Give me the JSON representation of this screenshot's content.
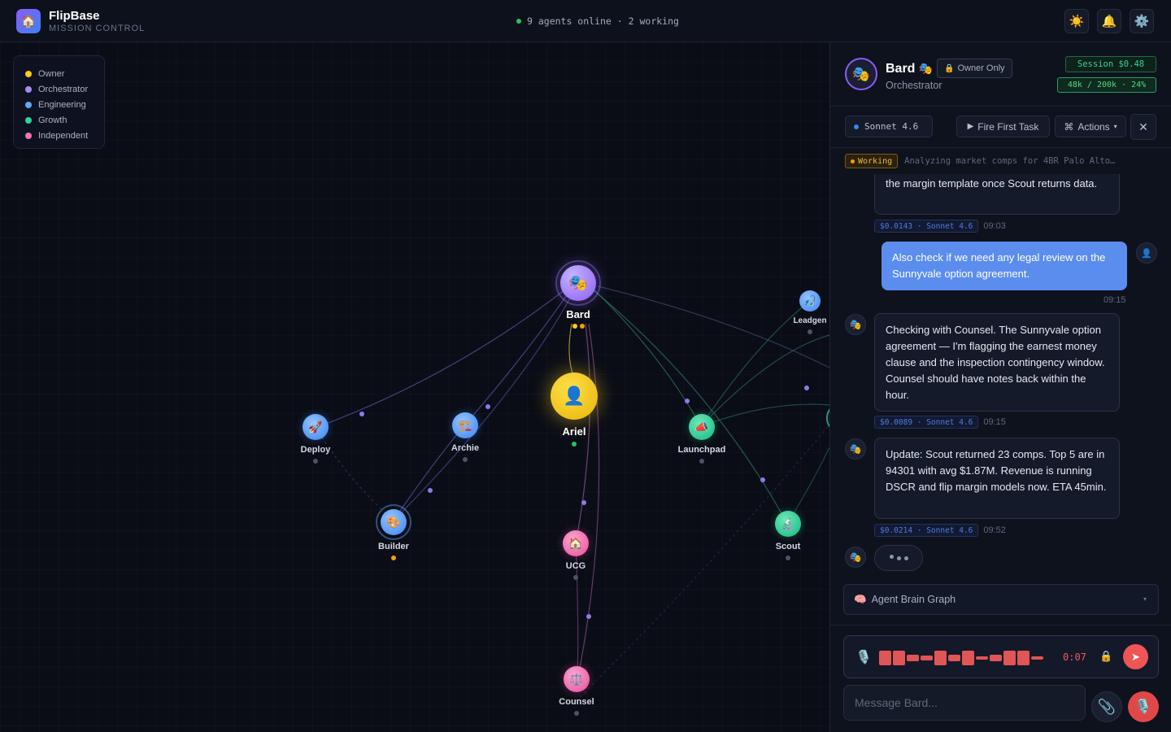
{
  "header": {
    "app_name": "FlipBase",
    "app_subtitle": "MISSION CONTROL",
    "logo_icon": "🏠",
    "online_status": "9 agents online · 2 working",
    "theme_icon": "☀️",
    "bell_icon": "🔔",
    "settings_icon": "⚙️"
  },
  "legend": {
    "items": [
      {
        "label": "Owner",
        "color": "#facc15"
      },
      {
        "label": "Orchestrator",
        "color": "#a78bfa"
      },
      {
        "label": "Engineering",
        "color": "#60a5fa"
      },
      {
        "label": "Growth",
        "color": "#34d399"
      },
      {
        "label": "Independent",
        "color": "#f472b6"
      }
    ]
  },
  "graph": {
    "nodes": [
      {
        "id": "bard",
        "label": "Bard",
        "icon": "🎭",
        "color": "#a78bfa",
        "group": "Orchestrator"
      },
      {
        "id": "ariel",
        "label": "Ariel",
        "icon": "👤",
        "color": "#facc15",
        "group": "Owner"
      },
      {
        "id": "deploy",
        "label": "Deploy",
        "icon": "🚀",
        "color": "#60a5fa",
        "group": "Engineering"
      },
      {
        "id": "archie",
        "label": "Archie",
        "icon": "🏗️",
        "color": "#60a5fa",
        "group": "Engineering"
      },
      {
        "id": "builder",
        "label": "Builder",
        "icon": "🎨",
        "color": "#60a5fa",
        "group": "Engineering"
      },
      {
        "id": "launchpad",
        "label": "Launchpad",
        "icon": "📣",
        "color": "#34d399",
        "group": "Growth"
      },
      {
        "id": "leadgen",
        "label": "Leadgen",
        "icon": "🎣",
        "color": "#60a5fa",
        "group": "Growth"
      },
      {
        "id": "scout",
        "label": "Scout",
        "icon": "🔬",
        "color": "#34d399",
        "group": "Growth"
      },
      {
        "id": "ucg",
        "label": "UCG",
        "icon": "🏠",
        "color": "#f472b6",
        "group": "Independent"
      },
      {
        "id": "counsel",
        "label": "Counsel",
        "icon": "⚖️",
        "color": "#f472b6",
        "group": "Independent"
      }
    ]
  },
  "panel": {
    "agent": {
      "name": "Bard",
      "icon": "🎭",
      "owner_only": "Owner Only",
      "lock_icon": "🔒",
      "role": "Orchestrator",
      "session_cost": "Session $0.48",
      "tokens": "48k / 200k · 24%"
    },
    "toolbar": {
      "model": "Sonnet 4.6",
      "fire_task": "Fire First Task",
      "actions": "Actions",
      "close_icon": "✕"
    },
    "status": {
      "badge": "Working",
      "text": "Analyzing market comps for 4BR Palo Alto…"
    },
    "messages": [
      {
        "role": "agent",
        "text": "the margin template once Scout returns data.",
        "cost": "$0.0143 · Sonnet 4.6",
        "time": "09:03"
      },
      {
        "role": "user",
        "text": "Also check if we need any legal review on the Sunnyvale option agreement.",
        "time": "09:15"
      },
      {
        "role": "agent",
        "text": "Checking with Counsel. The Sunnyvale option agreement — I'm flagging the earnest money clause and the inspection contingency window. Counsel should have notes back within the hour.",
        "cost": "$0.0089 · Sonnet 4.6",
        "time": "09:15"
      },
      {
        "role": "agent",
        "text": "Update: Scout returned 23 comps. Top 5 are in 94301 with avg $1.87M. Revenue is running DSCR and flip margin models now. ETA 45min.",
        "cost": "$0.0214 · Sonnet 4.6",
        "time": "09:52"
      }
    ],
    "brain_graph": {
      "label": "Agent Brain Graph",
      "icon": "🧠"
    },
    "recorder": {
      "time": "0:07",
      "mic_icon": "🎙️",
      "lock_icon": "🔒",
      "send_icon": "➤"
    },
    "composer": {
      "placeholder": "Message Bard...",
      "attach_icon": "📎",
      "mic_icon": "🎙️"
    }
  }
}
